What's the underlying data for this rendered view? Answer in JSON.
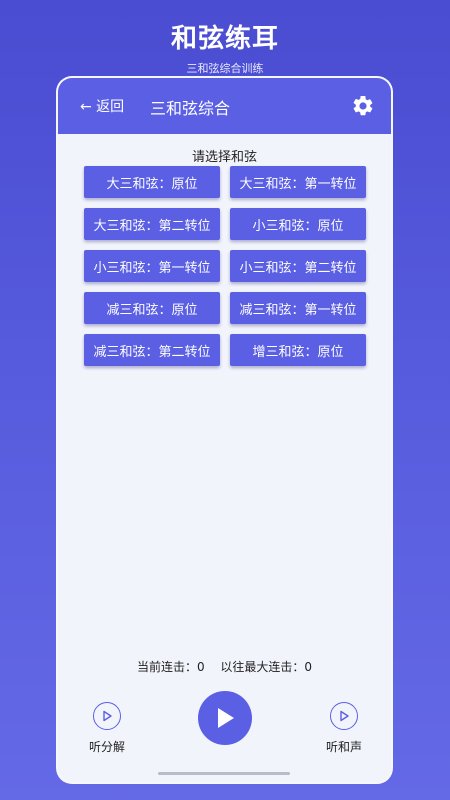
{
  "promo": {
    "title": "和弦练耳",
    "subtitle": "三和弦综合训练"
  },
  "topbar": {
    "back_label": "← 返回",
    "title": "三和弦综合",
    "settings_icon": "gear-icon"
  },
  "prompt": "请选择和弦",
  "chords": [
    "大三和弦：原位",
    "大三和弦：第一转位",
    "大三和弦：第二转位",
    "小三和弦：原位",
    "小三和弦：第一转位",
    "小三和弦：第二转位",
    "减三和弦：原位",
    "减三和弦：第一转位",
    "减三和弦：第二转位",
    "增三和弦：原位"
  ],
  "stats": {
    "current_streak": "当前连击：0",
    "best_streak": "以往最大连击：0"
  },
  "controls": {
    "left_label": "听分解",
    "right_label": "听和声",
    "play_icon": "play-icon"
  },
  "colors": {
    "accent": "#5b5fe4",
    "background": "#f2f4fc"
  }
}
